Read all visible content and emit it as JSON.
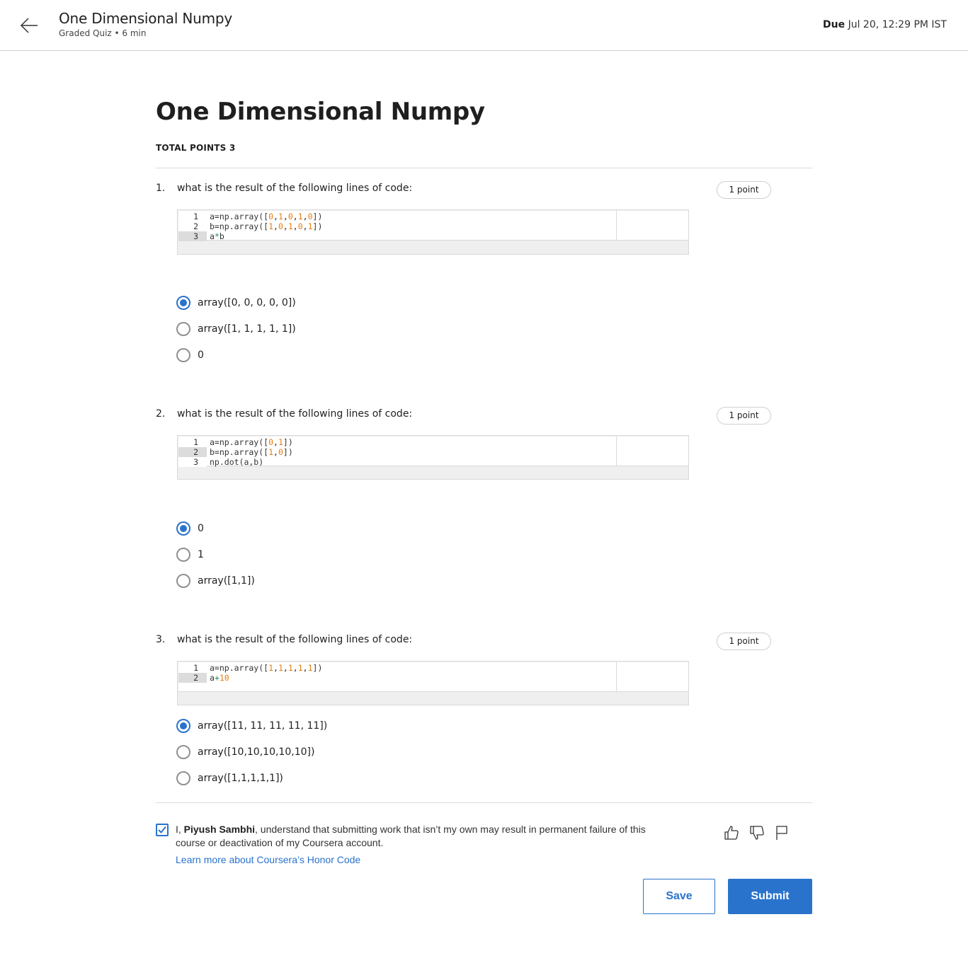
{
  "header": {
    "title": "One Dimensional Numpy",
    "subtitle": "Graded Quiz • 6 min",
    "due_label": "Due",
    "due_value": "Jul 20, 12:29 PM IST"
  },
  "quiz": {
    "title": "One Dimensional Numpy",
    "total_points": "TOTAL POINTS 3"
  },
  "questions": [
    {
      "number": "1.",
      "prompt": "what is the result of the following lines of code:",
      "points": "1 point",
      "code_lines": [
        {
          "ln": "1",
          "text": "a=np.array([0,1,0,1,0])"
        },
        {
          "ln": "2",
          "text": "b=np.array([1,0,1,0,1])"
        },
        {
          "ln": "3",
          "text": "a*b"
        }
      ],
      "options": [
        {
          "label": "array([0, 0, 0, 0, 0])",
          "checked": true
        },
        {
          "label": "array([1, 1, 1, 1, 1])",
          "checked": false
        },
        {
          "label": "0",
          "checked": false
        }
      ]
    },
    {
      "number": "2.",
      "prompt": "what is the result of the following lines of code:",
      "points": "1 point",
      "code_lines": [
        {
          "ln": "1",
          "text": "a=np.array([0,1])"
        },
        {
          "ln": "2",
          "text": "b=np.array([1,0])"
        },
        {
          "ln": "3",
          "text": "np.dot(a,b)"
        }
      ],
      "options": [
        {
          "label": "0",
          "checked": true
        },
        {
          "label": "1",
          "checked": false
        },
        {
          "label": "array([1,1])",
          "checked": false
        }
      ]
    },
    {
      "number": "3.",
      "prompt": "what is the result of the following lines of code:",
      "points": "1 point",
      "code_lines": [
        {
          "ln": "1",
          "text": "a=np.array([1,1,1,1,1])"
        },
        {
          "ln": "2",
          "text": "a+10"
        }
      ],
      "options": [
        {
          "label": "array([11, 11, 11, 11, 11])",
          "checked": true
        },
        {
          "label": "array([10,10,10,10,10])",
          "checked": false
        },
        {
          "label": "array([1,1,1,1,1])",
          "checked": false
        }
      ]
    }
  ],
  "honor": {
    "prefix": "I, ",
    "name": "Piyush Sambhi",
    "text": ", understand that submitting work that isn’t my own may result in permanent failure of this course or deactivation of my Coursera account.",
    "link": "Learn more about Coursera’s Honor Code",
    "checked": true
  },
  "actions": {
    "save": "Save",
    "submit": "Submit"
  },
  "colors": {
    "accent": "#2a73cc",
    "number": "#e37d12",
    "operator": "#2a8a55"
  }
}
